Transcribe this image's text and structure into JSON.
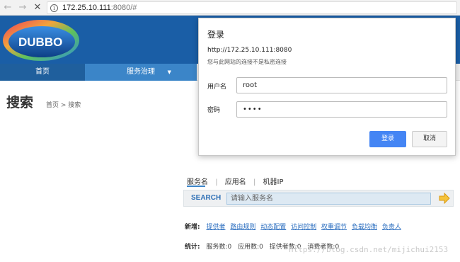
{
  "browser": {
    "url_host": "172.25.10.111",
    "url_rest": ":8080/#"
  },
  "logo_text": "DUBBO",
  "nav": {
    "home": "首页",
    "service_gov": "服务治理"
  },
  "page": {
    "title": "搜索",
    "breadcrumb": "首页 > 搜索"
  },
  "search": {
    "tabs": [
      "服务名",
      "应用名",
      "机器IP"
    ],
    "label": "SEARCH",
    "placeholder": "请输入服务名"
  },
  "add_row": {
    "label": "新增:",
    "links": [
      "提供者",
      "路由规则",
      "动态配置",
      "访问控制",
      "权重调节",
      "负载均衡",
      "负责人"
    ]
  },
  "stats_row": {
    "label": "统计:",
    "items": [
      "服务数:0",
      "应用数:0",
      "提供者数:0",
      "消费者数:0"
    ]
  },
  "watermark": "https://blog.csdn.net/mijichui2153",
  "dialog": {
    "title": "登录",
    "url": "http://172.25.10.111:8080",
    "note": "您与此网站的连接不是私密连接",
    "username_label": "用户名",
    "username_value": "root",
    "password_label": "密码",
    "password_value": "••••",
    "login_button": "登录",
    "cancel_button": "取消"
  },
  "colors": {
    "header_bg": "#1a5ea6",
    "tab_active": "#3b85c8",
    "primary_button": "#4485f4"
  }
}
